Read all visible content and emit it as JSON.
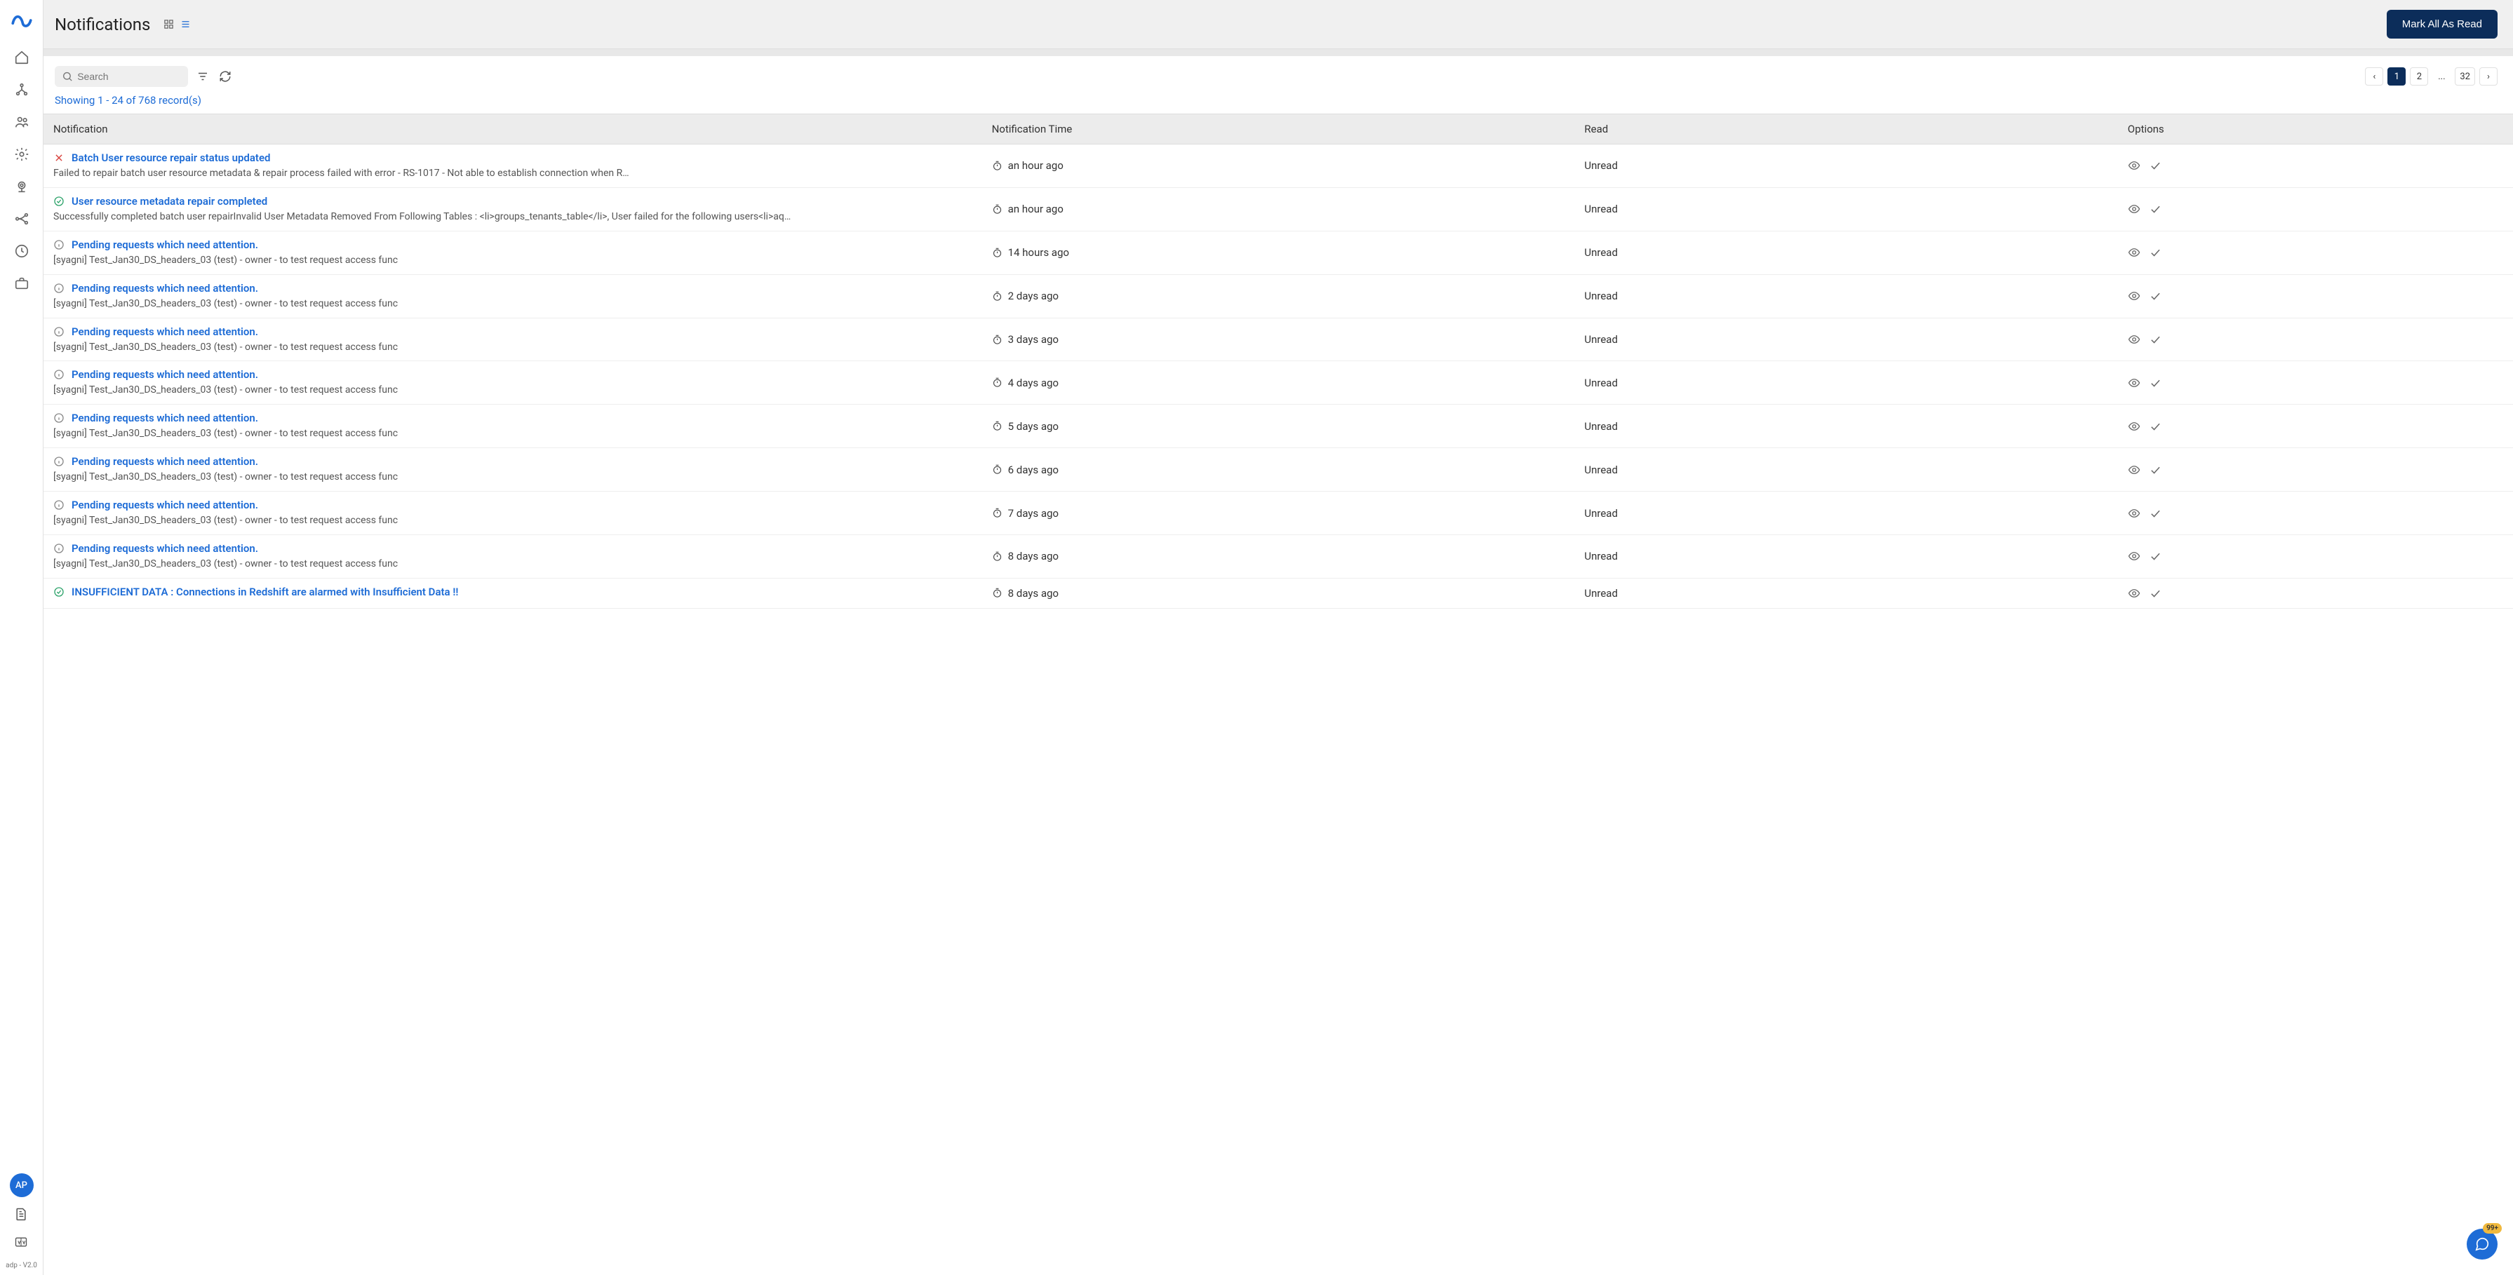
{
  "header": {
    "pageTitle": "Notifications",
    "markAllLabel": "Mark All As Read"
  },
  "search": {
    "placeholder": "Search"
  },
  "pagination": {
    "prev": "‹",
    "next": "›",
    "page1": "1",
    "page2": "2",
    "ellipsis": "...",
    "lastPage": "32"
  },
  "showing": "Showing 1 - 24 of 768 record(s)",
  "columns": {
    "notification": "Notification",
    "time": "Notification Time",
    "read": "Read",
    "options": "Options"
  },
  "avatarInitials": "AP",
  "version": "adp - V2.0",
  "chatBadge": "99+",
  "rows": [
    {
      "status": "error",
      "title": "Batch User resource repair status updated",
      "desc": "Failed to repair batch user resource metadata &\nrepair process failed with error - RS-1017 - Not able to establish connection when R…",
      "time": "an hour ago",
      "read": "Unread"
    },
    {
      "status": "success",
      "title": "User resource metadata repair completed",
      "desc": "Successfully completed batch user repairInvalid User Metadata Removed From Following Tables : <li>groups_tenants_table</li>, User failed for the following users<li>aq…",
      "time": "an hour ago",
      "read": "Unread"
    },
    {
      "status": "info",
      "title": "Pending requests which need attention.",
      "desc": "[syagni] Test_Jan30_DS_headers_03 (test) - owner - to test request access func",
      "time": "14 hours ago",
      "read": "Unread"
    },
    {
      "status": "info",
      "title": "Pending requests which need attention.",
      "desc": "[syagni] Test_Jan30_DS_headers_03 (test) - owner - to test request access func",
      "time": "2 days ago",
      "read": "Unread"
    },
    {
      "status": "info",
      "title": "Pending requests which need attention.",
      "desc": "[syagni] Test_Jan30_DS_headers_03 (test) - owner - to test request access func",
      "time": "3 days ago",
      "read": "Unread"
    },
    {
      "status": "info",
      "title": "Pending requests which need attention.",
      "desc": "[syagni] Test_Jan30_DS_headers_03 (test) - owner - to test request access func",
      "time": "4 days ago",
      "read": "Unread"
    },
    {
      "status": "info",
      "title": "Pending requests which need attention.",
      "desc": "[syagni] Test_Jan30_DS_headers_03 (test) - owner - to test request access func",
      "time": "5 days ago",
      "read": "Unread"
    },
    {
      "status": "info",
      "title": "Pending requests which need attention.",
      "desc": "[syagni] Test_Jan30_DS_headers_03 (test) - owner - to test request access func",
      "time": "6 days ago",
      "read": "Unread"
    },
    {
      "status": "info",
      "title": "Pending requests which need attention.",
      "desc": "[syagni] Test_Jan30_DS_headers_03 (test) - owner - to test request access func",
      "time": "7 days ago",
      "read": "Unread"
    },
    {
      "status": "info",
      "title": "Pending requests which need attention.",
      "desc": "[syagni] Test_Jan30_DS_headers_03 (test) - owner - to test request access func",
      "time": "8 days ago",
      "read": "Unread"
    },
    {
      "status": "success",
      "title": "INSUFFICIENT DATA : Connections in Redshift are alarmed with Insufficient Data !!",
      "desc": "",
      "time": "8 days ago",
      "read": "Unread"
    }
  ]
}
